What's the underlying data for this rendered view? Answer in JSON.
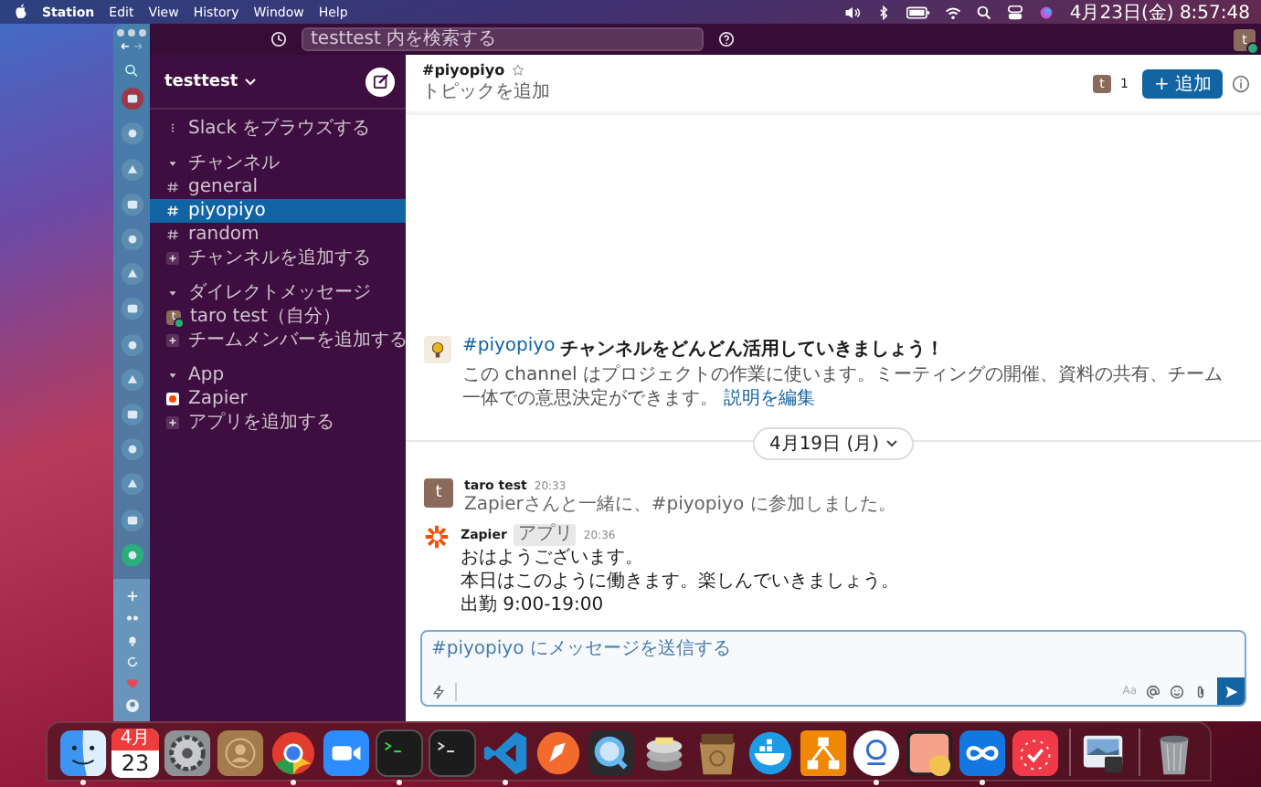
{
  "menu_bar": {
    "app": "Station",
    "menus": [
      "Edit",
      "View",
      "History",
      "Window",
      "Help"
    ],
    "clock": "4月23日(金) 8:57:48"
  },
  "top_bar": {
    "search_placeholder": "testtest 内を検索する",
    "avatar": "t",
    "online": true
  },
  "sidebar": {
    "workspace": "testtest",
    "browse": "Slack をブラウズする",
    "sections": [
      {
        "title": "チャンネル",
        "expanded": true,
        "items": [
          {
            "kind": "channel",
            "name": "general",
            "selected": false
          },
          {
            "kind": "channel",
            "name": "piyopiyo",
            "selected": true
          },
          {
            "kind": "channel",
            "name": "random",
            "selected": false
          },
          {
            "kind": "add",
            "name": "チャンネルを追加する",
            "selected": false
          }
        ]
      },
      {
        "title": "ダイレクトメッセージ",
        "expanded": true,
        "items": [
          {
            "kind": "person",
            "name": "taro test（自分）",
            "avatar": "t",
            "online": true,
            "selected": false
          },
          {
            "kind": "add",
            "name": "チームメンバーを追加する",
            "selected": false
          }
        ]
      },
      {
        "title": "App",
        "expanded": true,
        "items": [
          {
            "kind": "app",
            "name": "Zapier",
            "selected": false
          },
          {
            "kind": "add",
            "name": "アプリを追加する",
            "selected": false
          }
        ]
      }
    ]
  },
  "channel": {
    "name": "#piyopiyo",
    "starred": false,
    "topic": "トピックを追加",
    "member_avatar": "t",
    "member_count": "1",
    "add_button": "+ 追加"
  },
  "intro": {
    "channel_link": "#piyopiyo",
    "title": "チャンネルをどんどん活用していきましょう！",
    "description": "この channel はプロジェクトの作業に使います。ミーティングの開催、資料の共有、チーム一体での意思決定ができます。",
    "edit_link": "説明を編集"
  },
  "date_divider": "4月19日 (月)",
  "messages": [
    {
      "kind": "system",
      "author": "taro test",
      "avatar": "t",
      "time": "20:33",
      "lines": [
        "Zapierさんと一緒に、#piyopiyo に参加しました。"
      ]
    },
    {
      "kind": "bot",
      "author": "Zapier",
      "badge": "アプリ",
      "time": "20:36",
      "lines": [
        "おはようございます。",
        "本日はこのように働きます。楽しんでいきましょう。",
        "出勤 9:00-19:00"
      ]
    }
  ],
  "composer": {
    "placeholder": "#piyopiyo にメッセージを送信する",
    "format_label": "Aa"
  },
  "dock": {
    "calendar_month": "4月",
    "calendar_day": "23",
    "items": [
      {
        "kind": "finder",
        "running": true
      },
      {
        "kind": "calendar",
        "running": false
      },
      {
        "kind": "settings",
        "running": false
      },
      {
        "kind": "contacts",
        "running": false
      },
      {
        "kind": "browser",
        "running": true
      },
      {
        "kind": "video",
        "running": false
      },
      {
        "kind": "terminal",
        "running": true
      },
      {
        "kind": "terminal",
        "running": false
      },
      {
        "kind": "code",
        "running": true
      },
      {
        "kind": "pen",
        "running": false
      },
      {
        "kind": "player",
        "running": false
      },
      {
        "kind": "database",
        "running": false
      },
      {
        "kind": "archive",
        "running": false
      },
      {
        "kind": "whale",
        "running": false
      },
      {
        "kind": "diagram",
        "running": false
      },
      {
        "kind": "ring",
        "running": true
      },
      {
        "kind": "gallery",
        "running": false
      },
      {
        "kind": "infinity",
        "running": true
      },
      {
        "kind": "clock",
        "running": false
      },
      {
        "kind": "separator"
      },
      {
        "kind": "photo",
        "running": false
      },
      {
        "kind": "separator"
      },
      {
        "kind": "trash",
        "running": false
      }
    ]
  }
}
